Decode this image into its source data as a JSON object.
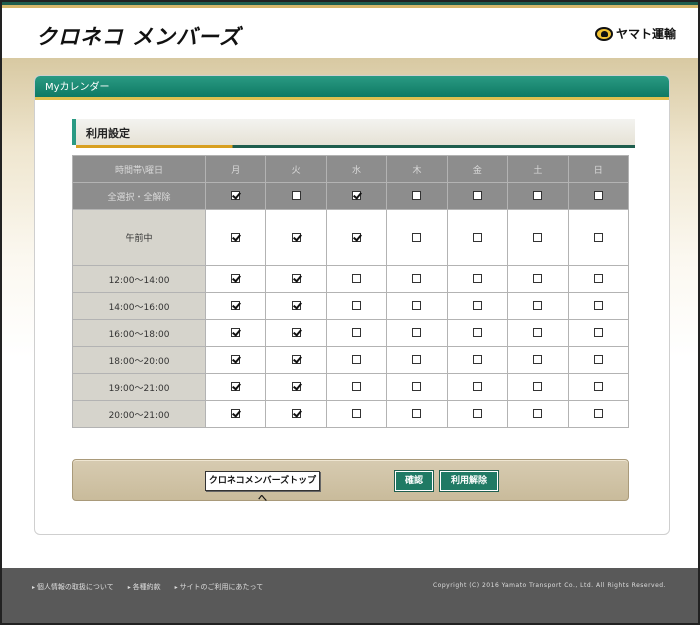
{
  "header": {
    "logo": "クロネコ メンバーズ",
    "brand": "ヤマト運輸"
  },
  "panel": {
    "title": "Myカレンダー",
    "section": "利用設定"
  },
  "table": {
    "corner": "時間帯\\曜日",
    "days": [
      "月",
      "火",
      "水",
      "木",
      "金",
      "土",
      "日"
    ],
    "select_all_label": "全選択・全解除",
    "select_all": [
      true,
      false,
      true,
      false,
      false,
      false,
      false
    ],
    "rows": [
      {
        "label": "午前中",
        "checks": [
          true,
          true,
          true,
          false,
          false,
          false,
          false
        ]
      },
      {
        "label": "12:00〜14:00",
        "checks": [
          true,
          true,
          false,
          false,
          false,
          false,
          false
        ]
      },
      {
        "label": "14:00〜16:00",
        "checks": [
          true,
          true,
          false,
          false,
          false,
          false,
          false
        ]
      },
      {
        "label": "16:00〜18:00",
        "checks": [
          true,
          true,
          false,
          false,
          false,
          false,
          false
        ]
      },
      {
        "label": "18:00〜20:00",
        "checks": [
          true,
          true,
          false,
          false,
          false,
          false,
          false
        ]
      },
      {
        "label": "19:00〜21:00",
        "checks": [
          true,
          true,
          false,
          false,
          false,
          false,
          false
        ]
      },
      {
        "label": "20:00〜21:00",
        "checks": [
          true,
          true,
          false,
          false,
          false,
          false,
          false
        ]
      }
    ]
  },
  "buttons": {
    "top": "クロネコメンバーズトップへ",
    "confirm": "確認",
    "cancel": "利用解除"
  },
  "footer": {
    "links": [
      "個人情報の取扱について",
      "各種約款",
      "サイトのご利用にあたって"
    ],
    "copyright": "Copyright (C) 2016 Yamato Transport Co., Ltd. All Rights Reserved."
  }
}
